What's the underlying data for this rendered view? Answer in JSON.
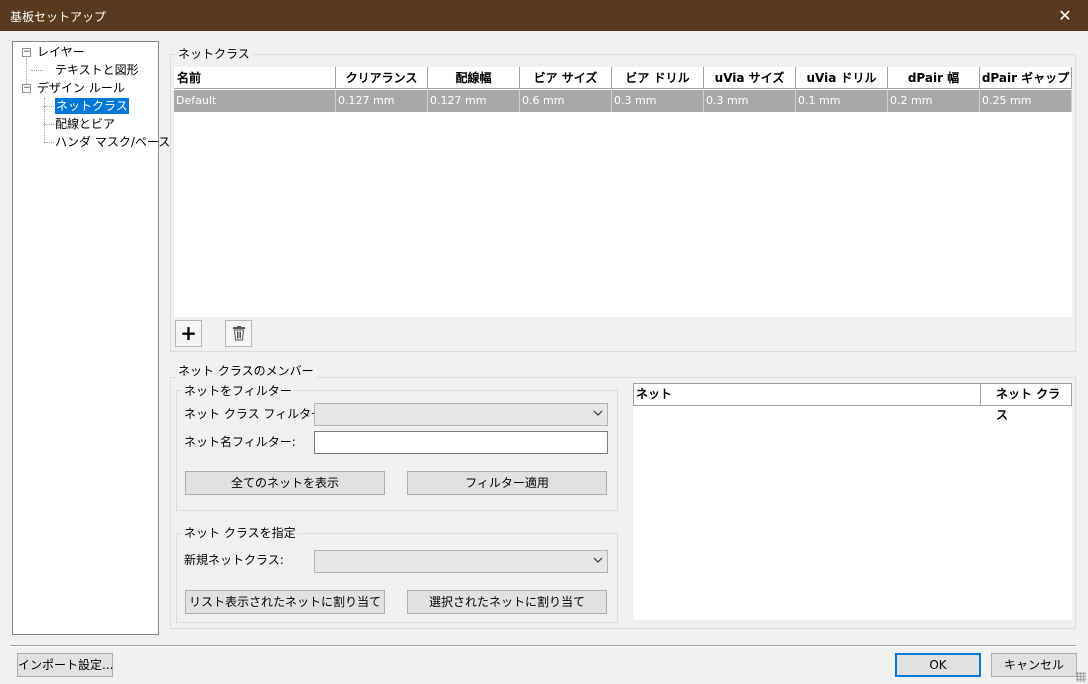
{
  "window": {
    "title": "基板セットアップ",
    "close_glyph": "✕"
  },
  "tree": {
    "items": [
      {
        "label": "レイヤー",
        "toggle": "−"
      },
      {
        "label": "テキストと図形"
      },
      {
        "label": "デザイン ルール",
        "toggle": "−"
      },
      {
        "label": "ネットクラス"
      },
      {
        "label": "配線とビア"
      },
      {
        "label": "ハンダ マスク/ペースト"
      }
    ]
  },
  "netclasses": {
    "group_label": "ネットクラス",
    "columns": [
      "名前",
      "クリアランス",
      "配線幅",
      "ビア サイズ",
      "ビア ドリル",
      "uVia サイズ",
      "uVia ドリル",
      "dPair 幅",
      "dPair ギャップ"
    ],
    "rows": [
      [
        "Default",
        "0.127 mm",
        "0.127 mm",
        "0.6 mm",
        "0.3 mm",
        "0.3 mm",
        "0.1 mm",
        "0.2 mm",
        "0.25 mm"
      ]
    ],
    "add_glyph": "+",
    "delete_icon": "trash-icon"
  },
  "members": {
    "group_label": "ネット クラスのメンバー",
    "filter": {
      "group_label": "ネットをフィルター",
      "netclass_filter_label": "ネット クラス フィルター:",
      "netname_filter_label": "ネット名フィルター:",
      "netname_filter_value": "",
      "show_all_label": "全てのネットを表示",
      "apply_filter_label": "フィルター適用"
    },
    "assign": {
      "group_label": "ネット クラスを指定",
      "new_netclass_label": "新規ネットクラス:",
      "assign_listed_label": "リスト表示されたネットに割り当て",
      "assign_selected_label": "選択されたネットに割り当て"
    },
    "net_table": {
      "columns": [
        "ネット",
        "ネット クラス"
      ]
    }
  },
  "footer": {
    "import_label": "インポート設定...",
    "ok_label": "OK",
    "cancel_label": "キャンセル"
  },
  "colors": {
    "titlebar": "#5a3a1e",
    "selection": "#0078d7",
    "row_highlight": "#a8a8a8"
  }
}
